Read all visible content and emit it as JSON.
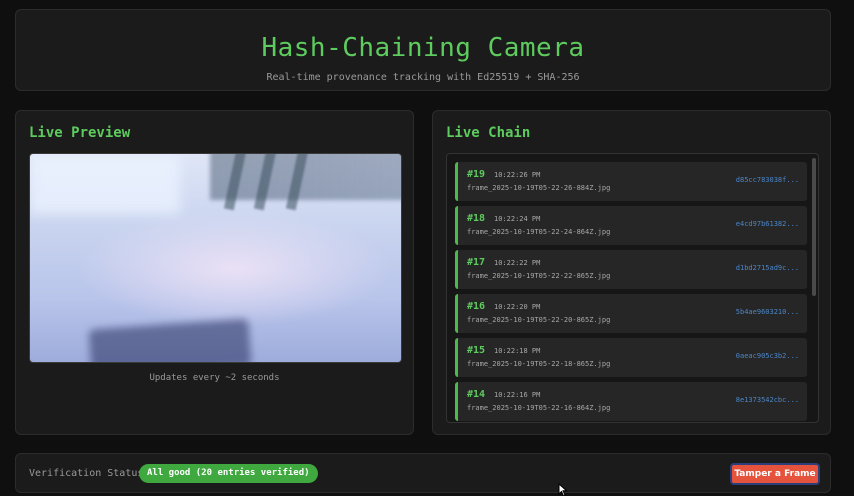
{
  "header": {
    "title": "Hash-Chaining Camera",
    "subtitle": "Real-time provenance tracking with Ed25519 + SHA-256"
  },
  "preview": {
    "title": "Live Preview",
    "caption": "Updates every ~2 seconds"
  },
  "chain": {
    "title": "Live Chain",
    "entries": [
      {
        "num": "#19",
        "time": "10:22:26 PM",
        "file": "frame_2025-10-19T05-22-26-884Z.jpg",
        "hash": "d85cc783038f..."
      },
      {
        "num": "#18",
        "time": "10:22:24 PM",
        "file": "frame_2025-10-19T05-22-24-864Z.jpg",
        "hash": "e4cd97b61382..."
      },
      {
        "num": "#17",
        "time": "10:22:22 PM",
        "file": "frame_2025-10-19T05-22-22-865Z.jpg",
        "hash": "d1bd2715ad9c..."
      },
      {
        "num": "#16",
        "time": "10:22:20 PM",
        "file": "frame_2025-10-19T05-22-20-865Z.jpg",
        "hash": "5b4ae9603210..."
      },
      {
        "num": "#15",
        "time": "10:22:18 PM",
        "file": "frame_2025-10-19T05-22-18-865Z.jpg",
        "hash": "0aeac905c3b2..."
      },
      {
        "num": "#14",
        "time": "10:22:16 PM",
        "file": "frame_2025-10-19T05-22-16-864Z.jpg",
        "hash": "8e1373542cbc..."
      }
    ]
  },
  "footer": {
    "status_label": "Verification Status:",
    "status_badge": "All good (20 entries verified)",
    "tamper_label": "Tamper a Frame"
  },
  "colors": {
    "accent": "#5ecb5e",
    "ok": "#3fa83f",
    "danger": "#e5533d",
    "hash": "#4b86c8"
  }
}
